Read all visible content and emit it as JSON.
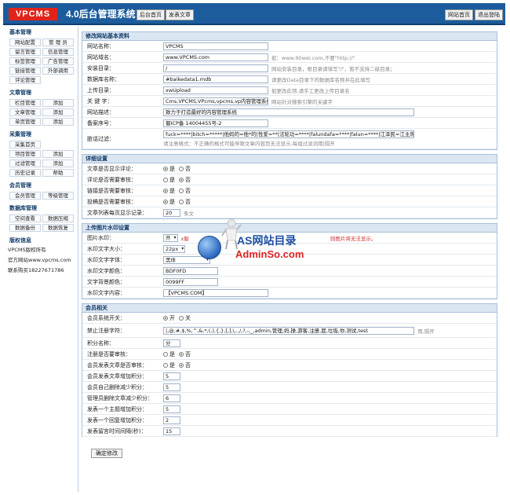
{
  "header": {
    "logo": "VPCMS",
    "title": "4.0后台管理系统",
    "home_button": "后台首页",
    "publish_button": "发表文章",
    "site_home_button": "网站首页",
    "logout_button": "退出登陆"
  },
  "sidebar": {
    "groups": [
      {
        "title": "基本管理",
        "items": [
          "网站配置",
          "管 理 员",
          "留言管理",
          "信息管理",
          "标签管理",
          "广告管理",
          "链接管理",
          "外部调用",
          "评论管理"
        ]
      },
      {
        "title": "文章管理",
        "items": [
          "栏目管理",
          "添加",
          "文章管理",
          "添加",
          "单页管理",
          "添加"
        ]
      },
      {
        "title": "采集管理",
        "items": [
          "采集首页",
          "项目管理",
          "添加",
          "过滤管理",
          "添加",
          "历史记录",
          "帮助"
        ]
      },
      {
        "title": "会员管理",
        "items": [
          "会员管理",
          "等级管理"
        ]
      },
      {
        "title": "数据库管理",
        "items": [
          "空间查看",
          "数据压缩",
          "数据备份",
          "数据恢复"
        ]
      }
    ],
    "copyright": {
      "title": "版权信息",
      "lines": [
        "VPCMS版权所有",
        "官方网站www.vpcms.com",
        "联系购买18227671786"
      ]
    }
  },
  "basic": {
    "title": "修改网站基本资料",
    "site_name": {
      "label": "网站名称：",
      "value": "VPCMS"
    },
    "site_domain": {
      "label": "网站域名：",
      "value": "www.VPCMS.com",
      "hint": "如：www.90wei.com,不要\"http://\""
    },
    "install_dir": {
      "label": "安装目录：",
      "value": "/",
      "hint": "网站安装目录，根目录请填写\"/\"，暂不支持二级目录；"
    },
    "db_name": {
      "label": "数据库名称：",
      "value": "#baikedata1.mdb",
      "hint": "请更改Data目录下的数据库名称并在此填写"
    },
    "upload_dir": {
      "label": "上传目录：",
      "value": "xwUpload",
      "hint": "如更改此项,请手工更改上传目录名"
    },
    "keywords": {
      "label": "关 键 字：",
      "value": "Cms,VPCMS,VPcms,vpcms,vp内容管理系统,最",
      "hint": "网站针对搜索引擎的关键字"
    },
    "description": {
      "label": "网站描述：",
      "value": "致力于打造最好的内容管理系统"
    },
    "icp": {
      "label": "备案序号：",
      "value": "蜀ICP备 14004455号-2"
    },
    "filter": {
      "label": "脏话过滤：",
      "value": "fuck=****|bitch=*****|他妈的=他*的|性爱=**|法轮功=****|falundafa=****|falun=****|江泽民=江主席|操你妈=操你",
      "hint": "请注意格式：不正确的格式可能导致文章内容页无法显示,每组过滤词用|隔开"
    }
  },
  "detail": {
    "title": "详细设置",
    "yes": "是",
    "no": "否",
    "article_comment": "文章是否显示评论：",
    "comment_review": "评论是否需要审核：",
    "link_review": "链接是否需要审核：",
    "submit_review": "投稿是否需要审核：",
    "page_count": {
      "label": "文章列表每页显示记录：",
      "value": "20",
      "hint": "条文"
    }
  },
  "upload": {
    "title": "上传图片水印设置",
    "watermark_image": {
      "label": "图片水印：",
      "value": "开",
      "hint_left": "x服",
      "hint_right": "则图片将无法显示。"
    },
    "text_size": {
      "label": "水印文字大小：",
      "value": "22px"
    },
    "font": {
      "label": "水印文字字体：",
      "value": "黑体"
    },
    "text_color": {
      "label": "水印文字颜色：",
      "value": "BDF0FD"
    },
    "bg_color": {
      "label": "文字背景颜色：",
      "value": "0099FF"
    },
    "content": {
      "label": "水印文字内容：",
      "value": "【VPCMS.COM】"
    }
  },
  "member": {
    "title": "会员相关",
    "on": "开",
    "off": "关",
    "yes": "是",
    "no": "否",
    "switch": "会员系统开关：",
    "forbidden": {
      "label": "禁止注册字符：",
      "value": "|,@,#,$,%,^,&,*,(,),{,},[,],\\,.,/,?,-,_,admin,管理,妈,操,游客,注册,屁,垃圾,你,测试,test",
      "hint": "用,隔开"
    },
    "points_name": {
      "label": "积分名称：",
      "value": "分"
    },
    "register_review": "注册是否要审核：",
    "publish_review": "会员发表文章是否审核：",
    "publish_points": {
      "label": "会员发表文章增加积分：",
      "value": "5"
    },
    "self_delete": {
      "label": "会员自己删除减少积分：",
      "value": "5"
    },
    "admin_delete": {
      "label": "管理员删除文章减少积分：",
      "value": "6"
    },
    "topic_points": {
      "label": "发表一个主题增加积分：",
      "value": "5"
    },
    "reply_points": {
      "label": "发表一个回复增加积分：",
      "value": "2"
    },
    "interval": {
      "label": "发表留言时间间隔(秒)：",
      "value": "15"
    }
  },
  "submit_label": "确定修改",
  "watermark": {
    "title": "AS网站目录",
    "subtitle": "AdminSo.com"
  },
  "colors": {
    "header": "#1d5c9c",
    "section_header": "#dbe6f3",
    "logo": "#e0241b"
  }
}
